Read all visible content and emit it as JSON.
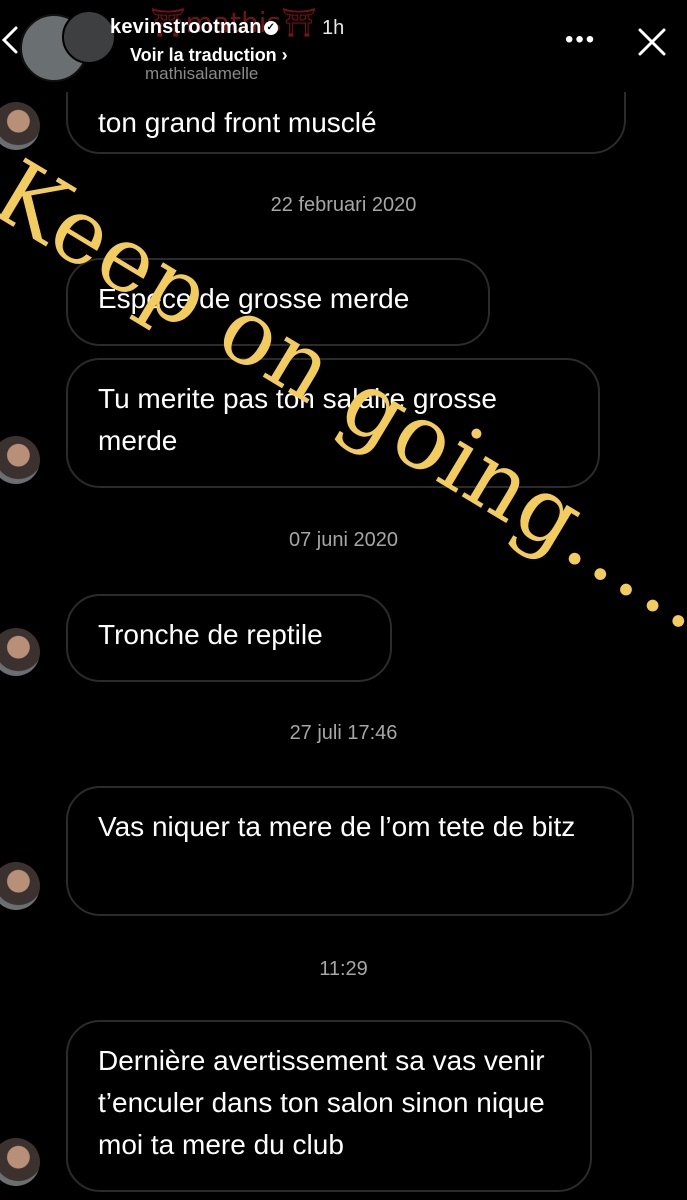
{
  "header": {
    "username": "kevinstrootman",
    "overlay_name": "⛩mathis⛩",
    "time": "1h",
    "translate_label": "Voir la traduction ›",
    "subhandle": "mathisalamelle",
    "more_label": "•••"
  },
  "overlay_text": "Keep on going……",
  "messages": [
    {
      "type": "bubble",
      "text": "ton grand front musclé"
    },
    {
      "type": "stamp",
      "text": "22 februari 2020"
    },
    {
      "type": "bubble",
      "text": "Espece de grosse merde"
    },
    {
      "type": "bubble",
      "text": "Tu merite pas ton salaire grosse merde"
    },
    {
      "type": "stamp",
      "text": "07 juni 2020"
    },
    {
      "type": "bubble",
      "text": "Tronche de reptile"
    },
    {
      "type": "stamp",
      "text": "27 juli 17:46"
    },
    {
      "type": "bubble",
      "text": "Vas niquer ta mere de l’om tete de bitz"
    },
    {
      "type": "stamp",
      "text": "11:29"
    },
    {
      "type": "bubble",
      "text": "Dernière avertissement sa vas venir t’enculer dans ton salon sinon nique moi ta mere du club"
    }
  ]
}
